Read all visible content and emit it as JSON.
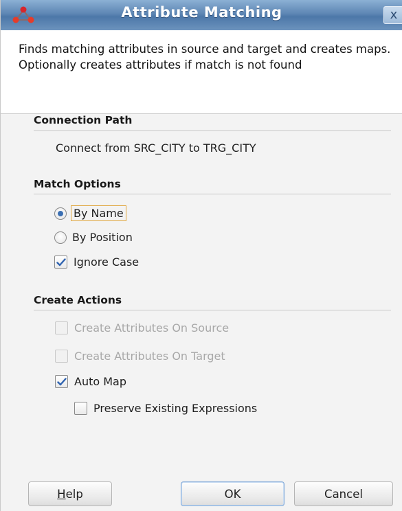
{
  "window": {
    "title": "Attribute Matching",
    "close_label": "x"
  },
  "description": {
    "text": "Finds matching attributes in source and target and creates maps.  Optionally creates attributes if match is not found"
  },
  "connection_path": {
    "heading": "Connection Path",
    "text": "Connect from SRC_CITY to TRG_CITY"
  },
  "match_options": {
    "heading": "Match Options",
    "by_name": {
      "label": "By Name",
      "selected": true
    },
    "by_position": {
      "label": "By Position",
      "selected": false
    },
    "ignore_case": {
      "label": "Ignore Case",
      "checked": true
    }
  },
  "create_actions": {
    "heading": "Create Actions",
    "create_on_source": {
      "label": "Create Attributes On Source",
      "checked": false,
      "enabled": false
    },
    "create_on_target": {
      "label": "Create Attributes On Target",
      "checked": false,
      "enabled": false
    },
    "auto_map": {
      "label": "Auto Map",
      "checked": true
    },
    "preserve_expressions": {
      "label": "Preserve Existing Expressions",
      "checked": false
    }
  },
  "buttons": {
    "help_mnemonic": "H",
    "help_rest": "elp",
    "ok": "OK",
    "cancel": "Cancel"
  },
  "colors": {
    "titlebar": "#5e86b4",
    "accent": "#3b6fb2",
    "focus": "#e0a53a"
  }
}
